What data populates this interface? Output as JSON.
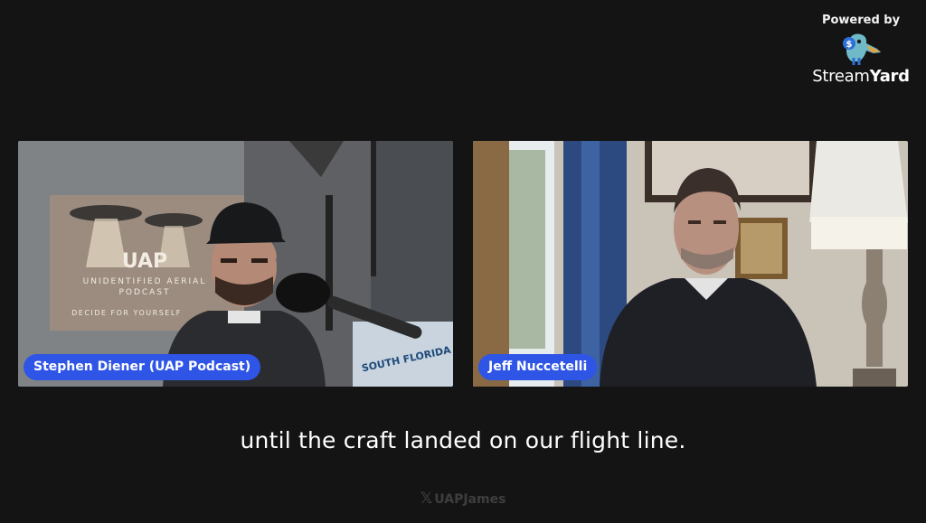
{
  "branding": {
    "powered_by": "Powered by",
    "name_regular": "Stream",
    "name_bold": "Yard"
  },
  "participants": [
    {
      "name": "Stephen Diener (UAP Podcast)"
    },
    {
      "name": "Jeff Nuccetelli"
    }
  ],
  "backdrop_banner": {
    "line1": "UAP",
    "line2": "UNIDENTIFIED AERIAL",
    "line3": "PODCAST",
    "line4": "DECIDE FOR YOURSELF"
  },
  "window_sticker": {
    "line1": "SOUTH FLORIDA"
  },
  "caption": "until the craft landed on our flight line.",
  "watermark": {
    "icon": "x-logo-icon",
    "handle": "UAPJames"
  },
  "colors": {
    "badge": "#2f55e6",
    "background": "#141414"
  }
}
